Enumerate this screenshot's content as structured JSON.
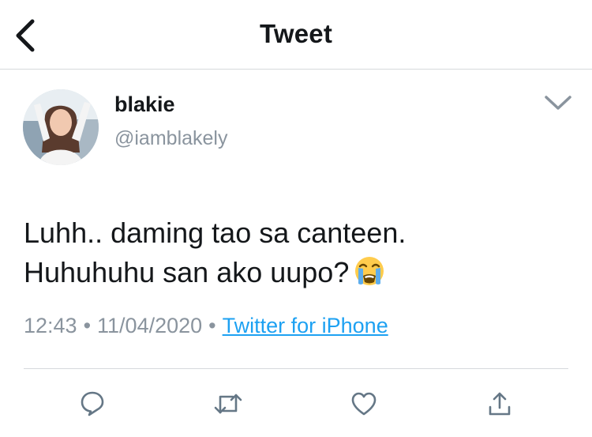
{
  "header": {
    "title": "Tweet",
    "back_icon": "chevron-left-icon"
  },
  "tweet": {
    "display_name": "blakie",
    "handle": "@iamblakely",
    "text_line1": "Luhh.. daming tao sa canteen.",
    "text_line2": "Huhuhuhu san ako uupo?",
    "emoji": "loudly-crying-face",
    "time": "12:43",
    "separator": "•",
    "date": "11/04/2020",
    "source": "Twitter for iPhone"
  },
  "actions": [
    "reply-icon",
    "retweet-icon",
    "like-icon",
    "share-icon"
  ],
  "colors": {
    "link": "#1da1f2",
    "muted": "#8a949e",
    "text": "#14171a",
    "icon": "#657786",
    "divider": "#d6d9dc"
  }
}
